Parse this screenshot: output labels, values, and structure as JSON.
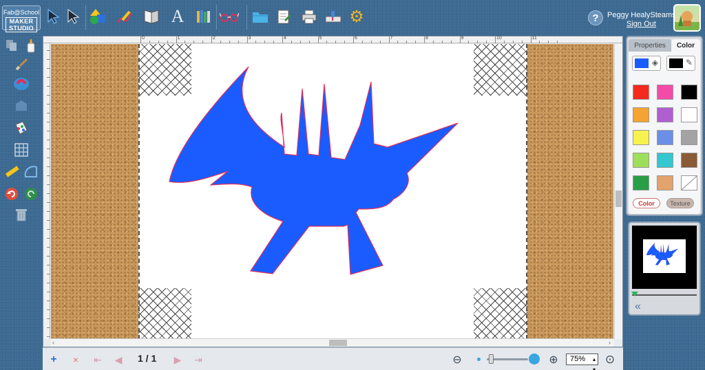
{
  "app": {
    "logo_line1": "Fab@School",
    "logo_line2": "MAKER STUDIO"
  },
  "top_toolbar": {
    "tools": [
      {
        "name": "select-tool",
        "glyph": "➤"
      },
      {
        "name": "point-edit-tool",
        "glyph": "➤"
      },
      {
        "name": "shapes-tool",
        "glyph": "◆"
      },
      {
        "name": "draw-tool",
        "glyph": "✎"
      },
      {
        "name": "fold-tool",
        "glyph": "▤"
      },
      {
        "name": "text-tool",
        "glyph": "A"
      },
      {
        "name": "library-tool",
        "glyph": "▥"
      },
      {
        "name": "preview-3d-tool",
        "glyph": "⌓"
      },
      {
        "name": "open-file",
        "glyph": "▭"
      },
      {
        "name": "save-file",
        "glyph": "✎"
      },
      {
        "name": "print",
        "glyph": "⎙"
      },
      {
        "name": "cutter",
        "glyph": "⌂"
      },
      {
        "name": "settings",
        "glyph": "⚙"
      }
    ]
  },
  "user": {
    "help_label": "?",
    "name": "Peggy HealySteams",
    "sign_out": "Sign Out"
  },
  "canvas": {
    "ruler_numbers": [
      "0",
      "1",
      "2",
      "3",
      "4",
      "5",
      "6",
      "7",
      "8",
      "9",
      "10",
      "11"
    ]
  },
  "bottom_bar": {
    "add_page": "+",
    "delete_page": "×",
    "first_page": "⇤",
    "prev_page": "◀",
    "page_counter": "1 / 1",
    "next_page": "▶",
    "last_page": "⇥",
    "zoom_out_icon": "⊖",
    "zoom_in_icon": "⊕",
    "zoom_level": "75%",
    "zoom_fit_icon": "⊙",
    "zoom_fraction": 0.08
  },
  "right_panel": {
    "tab_properties": "Properties",
    "tab_color": "Color",
    "fill_color": "#1a5cff",
    "stroke_color": "#000000",
    "swatches": [
      "#f5281e",
      "#f24ba8",
      "#000000",
      "#f5a332",
      "#b05fd1",
      "#ffffff",
      "#f7f24d",
      "#6b8fe6",
      "#a3a3a3",
      "#9fde5b",
      "#34c7cf",
      "#8b5a36",
      "#2a9e46",
      "#e3a36c",
      "none"
    ],
    "btn_color": "Color",
    "btn_texture": "Texture"
  },
  "design": {
    "fill": "#1a5cff",
    "stroke": "#e0305a"
  }
}
